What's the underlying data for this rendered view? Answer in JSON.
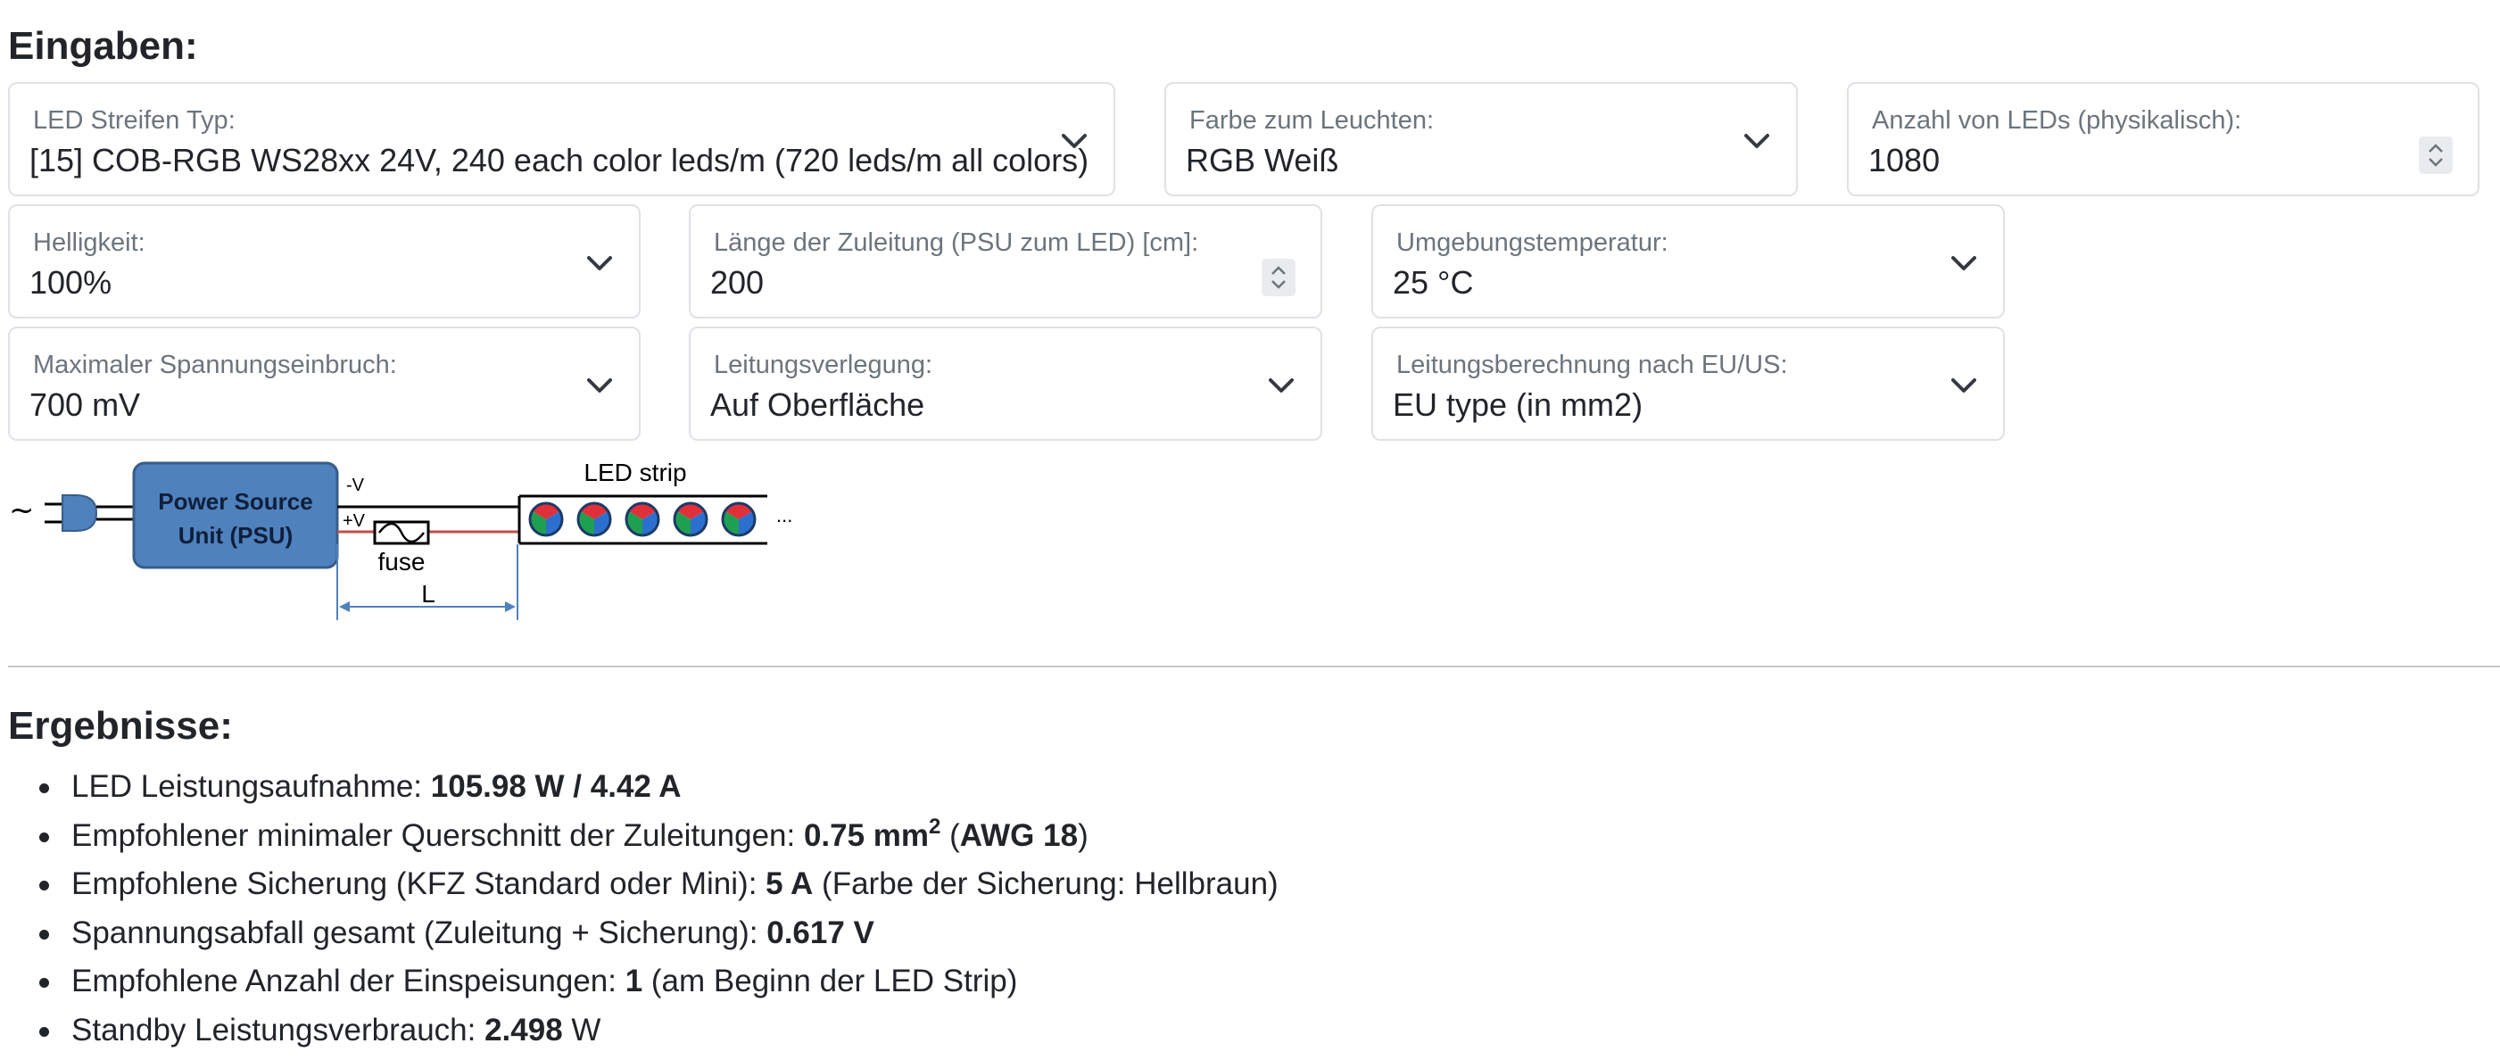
{
  "inputs": {
    "title": "Eingaben:",
    "led_type": {
      "label": "LED Streifen Typ:",
      "value": "[15] COB-RGB WS28xx 24V, 240 each color leds/m (720 leds/m all colors)"
    },
    "color": {
      "label": "Farbe zum Leuchten:",
      "value": "RGB Weiß"
    },
    "led_count": {
      "label": "Anzahl von LEDs (physikalisch):",
      "value": "1080"
    },
    "brightness": {
      "label": "Helligkeit:",
      "value": "100%"
    },
    "cable_length": {
      "label": "Länge der Zuleitung (PSU zum LED) [cm]:",
      "value": "200"
    },
    "ambient_temp": {
      "label": "Umgebungstemperatur:",
      "value": "25 °C"
    },
    "max_voltage_drop": {
      "label": "Maximaler Spannungseinbruch:",
      "value": "700 mV"
    },
    "cable_routing": {
      "label": "Leitungsverlegung:",
      "value": "Auf Oberfläche"
    },
    "cable_standard": {
      "label": "Leitungsberechnung nach EU/US:",
      "value": "EU type (in mm2)"
    }
  },
  "diagram": {
    "ac_symbol": "~",
    "psu_line1": "Power Source",
    "psu_line2": "Unit (PSU)",
    "neg_label": "-V",
    "pos_label": "+V",
    "fuse_label": "fuse",
    "strip_label": "LED strip",
    "length_label": "L",
    "ellipsis": "..."
  },
  "results": {
    "title": "Ergebnisse:",
    "power": {
      "label": "LED Leistungsaufnahme: ",
      "watts": "105.98 W",
      "sep": " / ",
      "amps": "4.42 A"
    },
    "cross_section": {
      "label": "Empfohlener minimaler Querschnitt der Zuleitungen: ",
      "value": "0.75 mm",
      "sup": "2",
      "open": " (",
      "awg": "AWG 18",
      "close": ")"
    },
    "fuse": {
      "label": "Empfohlene Sicherung (KFZ Standard oder Mini): ",
      "value": "5 A",
      "note": " (Farbe der Sicherung: Hellbraun)"
    },
    "voltage_drop": {
      "label": "Spannungsabfall gesamt (Zuleitung + Sicherung): ",
      "value": "0.617 V"
    },
    "feeds": {
      "label": "Empfohlene Anzahl der Einspeisungen: ",
      "value": "1",
      "note": " (am Beginn der LED Strip)"
    },
    "standby": {
      "label": "Standby Leistungsverbrauch: ",
      "value": "2.498",
      "unit": " W"
    }
  },
  "colors": {
    "psu_fill": "#4f81bd",
    "psu_stroke": "#385d8a",
    "wire_positive": "#c0504d",
    "dimension_line": "#4f81bd",
    "led_red": "#e0303a",
    "led_green": "#1fa050",
    "led_blue": "#2c6fcf"
  },
  "icons": {
    "select": "chevron-down-icon",
    "number": "spinner-arrows-icon",
    "plug": "plug-icon"
  }
}
